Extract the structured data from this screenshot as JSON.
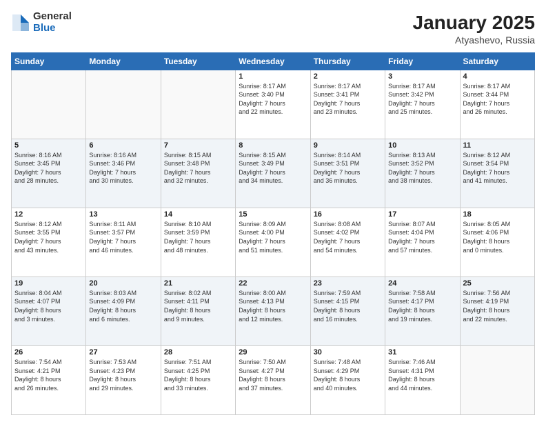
{
  "logo": {
    "general": "General",
    "blue": "Blue"
  },
  "header": {
    "month": "January 2025",
    "location": "Atyashevo, Russia"
  },
  "weekdays": [
    "Sunday",
    "Monday",
    "Tuesday",
    "Wednesday",
    "Thursday",
    "Friday",
    "Saturday"
  ],
  "weeks": [
    [
      {
        "day": "",
        "info": ""
      },
      {
        "day": "",
        "info": ""
      },
      {
        "day": "",
        "info": ""
      },
      {
        "day": "1",
        "info": "Sunrise: 8:17 AM\nSunset: 3:40 PM\nDaylight: 7 hours\nand 22 minutes."
      },
      {
        "day": "2",
        "info": "Sunrise: 8:17 AM\nSunset: 3:41 PM\nDaylight: 7 hours\nand 23 minutes."
      },
      {
        "day": "3",
        "info": "Sunrise: 8:17 AM\nSunset: 3:42 PM\nDaylight: 7 hours\nand 25 minutes."
      },
      {
        "day": "4",
        "info": "Sunrise: 8:17 AM\nSunset: 3:44 PM\nDaylight: 7 hours\nand 26 minutes."
      }
    ],
    [
      {
        "day": "5",
        "info": "Sunrise: 8:16 AM\nSunset: 3:45 PM\nDaylight: 7 hours\nand 28 minutes."
      },
      {
        "day": "6",
        "info": "Sunrise: 8:16 AM\nSunset: 3:46 PM\nDaylight: 7 hours\nand 30 minutes."
      },
      {
        "day": "7",
        "info": "Sunrise: 8:15 AM\nSunset: 3:48 PM\nDaylight: 7 hours\nand 32 minutes."
      },
      {
        "day": "8",
        "info": "Sunrise: 8:15 AM\nSunset: 3:49 PM\nDaylight: 7 hours\nand 34 minutes."
      },
      {
        "day": "9",
        "info": "Sunrise: 8:14 AM\nSunset: 3:51 PM\nDaylight: 7 hours\nand 36 minutes."
      },
      {
        "day": "10",
        "info": "Sunrise: 8:13 AM\nSunset: 3:52 PM\nDaylight: 7 hours\nand 38 minutes."
      },
      {
        "day": "11",
        "info": "Sunrise: 8:12 AM\nSunset: 3:54 PM\nDaylight: 7 hours\nand 41 minutes."
      }
    ],
    [
      {
        "day": "12",
        "info": "Sunrise: 8:12 AM\nSunset: 3:55 PM\nDaylight: 7 hours\nand 43 minutes."
      },
      {
        "day": "13",
        "info": "Sunrise: 8:11 AM\nSunset: 3:57 PM\nDaylight: 7 hours\nand 46 minutes."
      },
      {
        "day": "14",
        "info": "Sunrise: 8:10 AM\nSunset: 3:59 PM\nDaylight: 7 hours\nand 48 minutes."
      },
      {
        "day": "15",
        "info": "Sunrise: 8:09 AM\nSunset: 4:00 PM\nDaylight: 7 hours\nand 51 minutes."
      },
      {
        "day": "16",
        "info": "Sunrise: 8:08 AM\nSunset: 4:02 PM\nDaylight: 7 hours\nand 54 minutes."
      },
      {
        "day": "17",
        "info": "Sunrise: 8:07 AM\nSunset: 4:04 PM\nDaylight: 7 hours\nand 57 minutes."
      },
      {
        "day": "18",
        "info": "Sunrise: 8:05 AM\nSunset: 4:06 PM\nDaylight: 8 hours\nand 0 minutes."
      }
    ],
    [
      {
        "day": "19",
        "info": "Sunrise: 8:04 AM\nSunset: 4:07 PM\nDaylight: 8 hours\nand 3 minutes."
      },
      {
        "day": "20",
        "info": "Sunrise: 8:03 AM\nSunset: 4:09 PM\nDaylight: 8 hours\nand 6 minutes."
      },
      {
        "day": "21",
        "info": "Sunrise: 8:02 AM\nSunset: 4:11 PM\nDaylight: 8 hours\nand 9 minutes."
      },
      {
        "day": "22",
        "info": "Sunrise: 8:00 AM\nSunset: 4:13 PM\nDaylight: 8 hours\nand 12 minutes."
      },
      {
        "day": "23",
        "info": "Sunrise: 7:59 AM\nSunset: 4:15 PM\nDaylight: 8 hours\nand 16 minutes."
      },
      {
        "day": "24",
        "info": "Sunrise: 7:58 AM\nSunset: 4:17 PM\nDaylight: 8 hours\nand 19 minutes."
      },
      {
        "day": "25",
        "info": "Sunrise: 7:56 AM\nSunset: 4:19 PM\nDaylight: 8 hours\nand 22 minutes."
      }
    ],
    [
      {
        "day": "26",
        "info": "Sunrise: 7:54 AM\nSunset: 4:21 PM\nDaylight: 8 hours\nand 26 minutes."
      },
      {
        "day": "27",
        "info": "Sunrise: 7:53 AM\nSunset: 4:23 PM\nDaylight: 8 hours\nand 29 minutes."
      },
      {
        "day": "28",
        "info": "Sunrise: 7:51 AM\nSunset: 4:25 PM\nDaylight: 8 hours\nand 33 minutes."
      },
      {
        "day": "29",
        "info": "Sunrise: 7:50 AM\nSunset: 4:27 PM\nDaylight: 8 hours\nand 37 minutes."
      },
      {
        "day": "30",
        "info": "Sunrise: 7:48 AM\nSunset: 4:29 PM\nDaylight: 8 hours\nand 40 minutes."
      },
      {
        "day": "31",
        "info": "Sunrise: 7:46 AM\nSunset: 4:31 PM\nDaylight: 8 hours\nand 44 minutes."
      },
      {
        "day": "",
        "info": ""
      }
    ]
  ]
}
